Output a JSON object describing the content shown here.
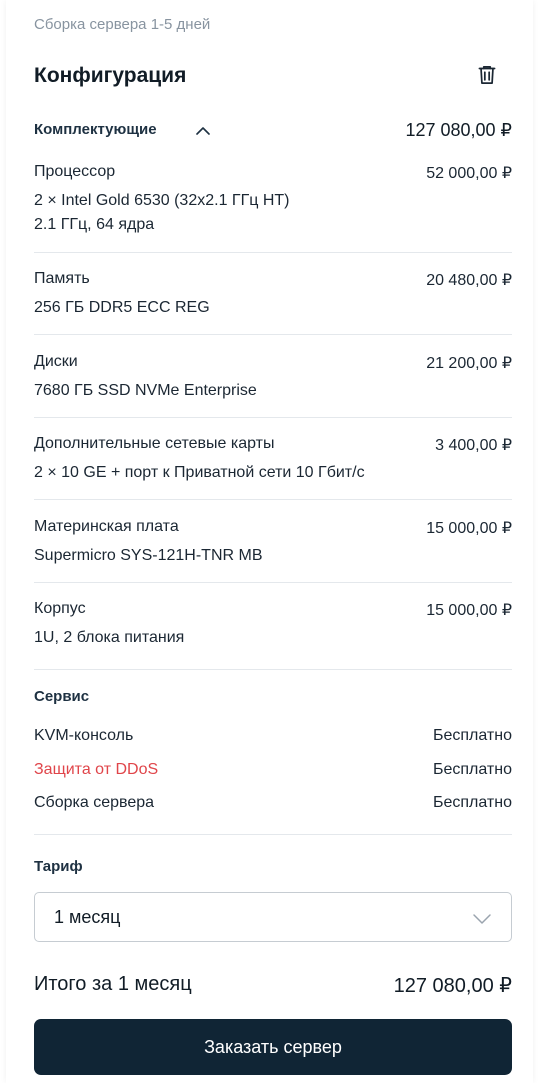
{
  "header": {
    "assembly_note": "Сборка сервера 1-5 дней",
    "title": "Конфигурация",
    "trash_icon": "trash-icon"
  },
  "components": {
    "label": "Комплектующие",
    "total": "127 080,00 ₽",
    "items": [
      {
        "name": "Процессор",
        "price": "52 000,00 ₽",
        "details": [
          "2 × Intel Gold 6530 (32x2.1 ГГц HT)",
          "2.1 ГГц, 64 ядра"
        ]
      },
      {
        "name": "Память",
        "price": "20 480,00 ₽",
        "details": [
          "256 ГБ DDR5 ECC REG"
        ]
      },
      {
        "name": "Диски",
        "price": "21 200,00 ₽",
        "details": [
          "7680 ГБ SSD NVMe Enterprise"
        ]
      },
      {
        "name": "Дополнительные сетевые карты",
        "price": "3 400,00 ₽",
        "details": [
          "2 × 10 GE + порт к Приватной сети 10 Гбит/с"
        ]
      },
      {
        "name": "Материнская плата",
        "price": "15 000,00 ₽",
        "details": [
          "Supermicro SYS-121H-TNR MB"
        ]
      },
      {
        "name": "Корпус",
        "price": "15 000,00 ₽",
        "details": [
          "1U, 2 блока питания"
        ]
      }
    ]
  },
  "service": {
    "label": "Сервис",
    "items": [
      {
        "name": "KVM-консоль",
        "price": "Бесплатно"
      },
      {
        "name": "Защита от DDoS",
        "price": "Бесплатно"
      },
      {
        "name": "Сборка сервера",
        "price": "Бесплатно"
      }
    ]
  },
  "tariff": {
    "label": "Тариф",
    "selected": "1 месяц"
  },
  "summary": {
    "label": "Итого за 1 месяц",
    "total": "127 080,00 ₽"
  },
  "actions": {
    "order_label": "Заказать сервер"
  },
  "colors": {
    "button_bg": "#102535",
    "ddos_link": "#e0454a",
    "muted_text": "#8894a0"
  }
}
